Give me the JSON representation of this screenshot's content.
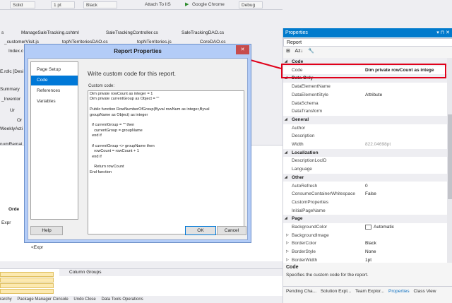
{
  "toolbar": {
    "solution_config": "Solid",
    "platform": "1 pt",
    "dropdown": "Black",
    "attach": "Attach To IIS",
    "browser": "Google Chrome",
    "build_config": "Debug"
  },
  "doc_tabs": [
    {
      "label": "s"
    },
    {
      "label": "ManageSaleTracking.cshtml"
    },
    {
      "label": "SaleTrackingController.cs"
    },
    {
      "label": "SaleTrackingDAO.cs"
    },
    {
      "label": "_customerVisit.js"
    },
    {
      "label": "topNTerritoriesDAO.cs"
    },
    {
      "label": "topNTerritories.js"
    },
    {
      "label": "CoreDAO.cs"
    },
    {
      "label": "Index.c"
    }
  ],
  "side_labels": [
    "E.rdlc [Desi",
    "Summary",
    "_Inventor",
    "Ur",
    "Or",
    "WeeklyActi",
    "numRemai",
    "Orde",
    "Expr",
    "<Expr"
  ],
  "column_groups": "Column Groups",
  "status_items": [
    "rarchy",
    "Package Manager Console",
    "Undo Close",
    "Data Tools Operations"
  ],
  "dialog": {
    "title": "Report Properties",
    "close": "✕",
    "nav": [
      "Page Setup",
      "Code",
      "References",
      "Variables"
    ],
    "heading": "Write custom code for this report.",
    "code_label": "Custom code:",
    "code_lines": [
      "Dim private rowCount as integer = 1",
      "Dim private currentGroup as Object = \"\"",
      "",
      "Public function RowNumberOfGroup(Byval rowNum as integer,Byval",
      "groupName as Object) as integer",
      "",
      "  if currentGroup = \"\" then",
      "    currentGroup = groupName",
      "  end if",
      "",
      "  if currentGroup <> groupName then",
      "    rowCount = rowCount + 1",
      "  end if",
      "",
      "    Return rowCount",
      "End function"
    ],
    "help": "Help",
    "ok": "OK",
    "cancel": "Cancel"
  },
  "properties": {
    "title": "Properties",
    "subject": "Report",
    "tools": [
      "⊞",
      "Az↓",
      "🔧"
    ],
    "rows": [
      {
        "type": "cat",
        "name": "Code"
      },
      {
        "type": "prop",
        "name": "Code",
        "value": "Dim private rowCount as intege",
        "bold": true
      },
      {
        "type": "cat",
        "name": "Data Only"
      },
      {
        "type": "prop",
        "name": "DataElementName",
        "value": ""
      },
      {
        "type": "prop",
        "name": "DataElementStyle",
        "value": "Attribute"
      },
      {
        "type": "prop",
        "name": "DataSchema",
        "value": ""
      },
      {
        "type": "prop",
        "name": "DataTransform",
        "value": ""
      },
      {
        "type": "cat",
        "name": "General"
      },
      {
        "type": "prop",
        "name": "Author",
        "value": ""
      },
      {
        "type": "prop",
        "name": "Description",
        "value": ""
      },
      {
        "type": "prop",
        "name": "Width",
        "value": "822.04698pt",
        "dim": true
      },
      {
        "type": "cat",
        "name": "Localization"
      },
      {
        "type": "prop",
        "name": "DescriptionLocID",
        "value": ""
      },
      {
        "type": "prop",
        "name": "Language",
        "value": ""
      },
      {
        "type": "cat",
        "name": "Other"
      },
      {
        "type": "prop",
        "name": "AutoRefresh",
        "value": "0"
      },
      {
        "type": "prop",
        "name": "ConsumeContainerWhitespace",
        "value": "False"
      },
      {
        "type": "prop",
        "name": "CustomProperties",
        "value": ""
      },
      {
        "type": "prop",
        "name": "InitialPageName",
        "value": ""
      },
      {
        "type": "cat",
        "name": "Page"
      },
      {
        "type": "prop",
        "name": "BackgroundColor",
        "value": "Automatic",
        "swatch": true
      },
      {
        "type": "prop",
        "name": "BackgroundImage",
        "value": "",
        "expand": true
      },
      {
        "type": "prop",
        "name": "BorderColor",
        "value": "Black",
        "expand": true
      },
      {
        "type": "prop",
        "name": "BorderStyle",
        "value": "None",
        "expand": true
      },
      {
        "type": "prop",
        "name": "BorderWidth",
        "value": "1pt",
        "expand": true
      }
    ],
    "desc_title": "Code",
    "desc_text": "Specifies the custom code for the report.",
    "bottom_tabs": [
      {
        "label": "Pending Cha..."
      },
      {
        "label": "Solution Expl..."
      },
      {
        "label": "Team Explor..."
      },
      {
        "label": "Properties",
        "active": true
      },
      {
        "label": "Class View"
      }
    ]
  },
  "colors": {
    "accent": "#007acc",
    "highlight": "#e0001a",
    "dialog_frame": "#b3ccf7",
    "nav_selected": "#0078d7"
  }
}
